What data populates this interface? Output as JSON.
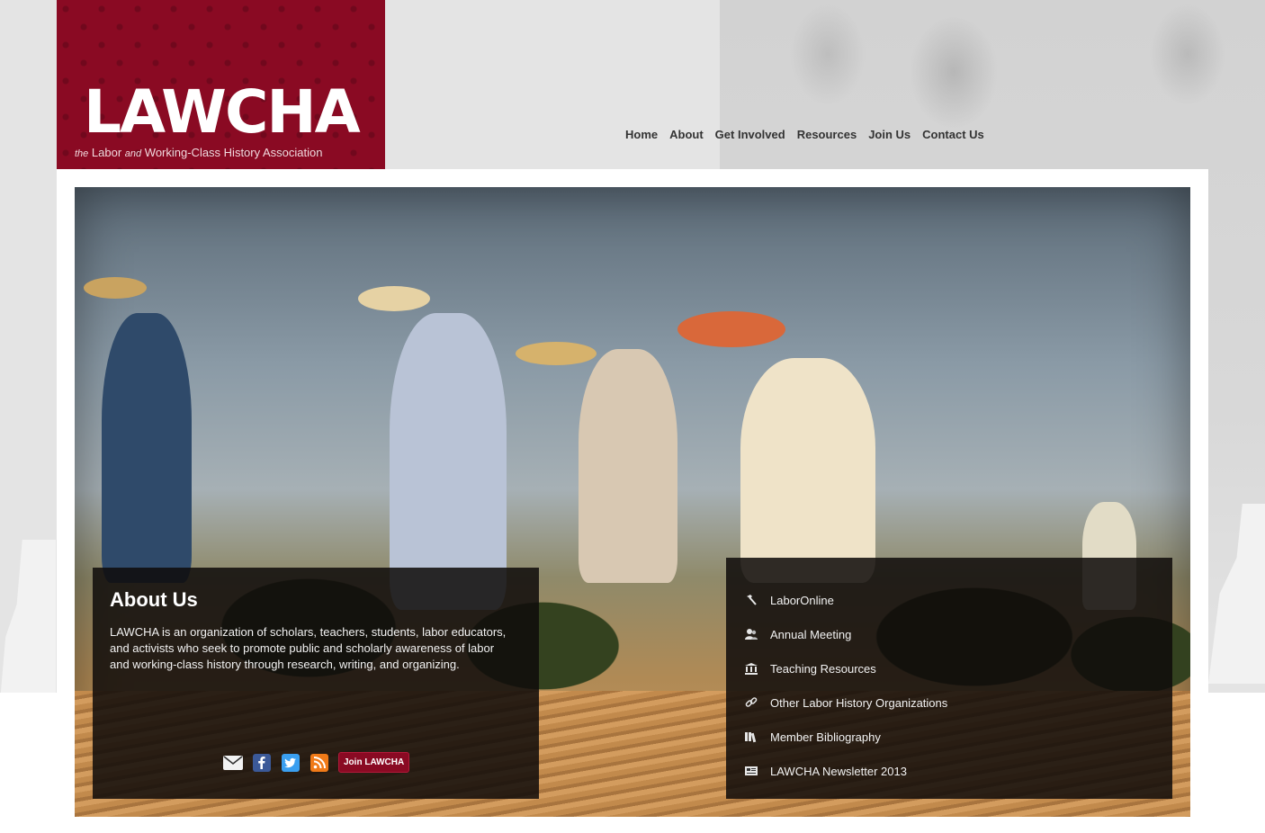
{
  "header": {
    "logo_title": "LAWCHA",
    "logo_sub_prefix": "the",
    "logo_sub_main": "Labor",
    "logo_sub_and": "and",
    "logo_sub_rest": "Working-Class History Association"
  },
  "nav": {
    "items": [
      {
        "label": "Home"
      },
      {
        "label": "About"
      },
      {
        "label": "Get Involved"
      },
      {
        "label": "Resources"
      },
      {
        "label": "Join Us"
      },
      {
        "label": "Contact Us"
      }
    ]
  },
  "about": {
    "title": "About Us",
    "text": "LAWCHA is an organization of scholars, teachers, students, labor educators, and activists who seek to promote public and scholarly awareness of labor and working-class history through research, writing, and organizing.",
    "join_label": "Join LAWCHA",
    "social_icons": [
      "email-icon",
      "facebook-icon",
      "twitter-icon",
      "rss-icon"
    ]
  },
  "links": {
    "items": [
      {
        "label": "LaborOnline",
        "icon": "hammer-icon"
      },
      {
        "label": "Annual Meeting",
        "icon": "people-icon"
      },
      {
        "label": "Teaching Resources",
        "icon": "institution-icon"
      },
      {
        "label": "Other Labor History Organizations",
        "icon": "link-icon"
      },
      {
        "label": "Member Bibliography",
        "icon": "books-icon"
      },
      {
        "label": "LAWCHA Newsletter 2013",
        "icon": "newspaper-icon"
      }
    ]
  },
  "colors": {
    "brand": "#8a0a23",
    "overlay": "#0f0c0a",
    "facebook": "#3b5998",
    "twitter": "#3a9ff0",
    "rss": "#f07a18"
  }
}
